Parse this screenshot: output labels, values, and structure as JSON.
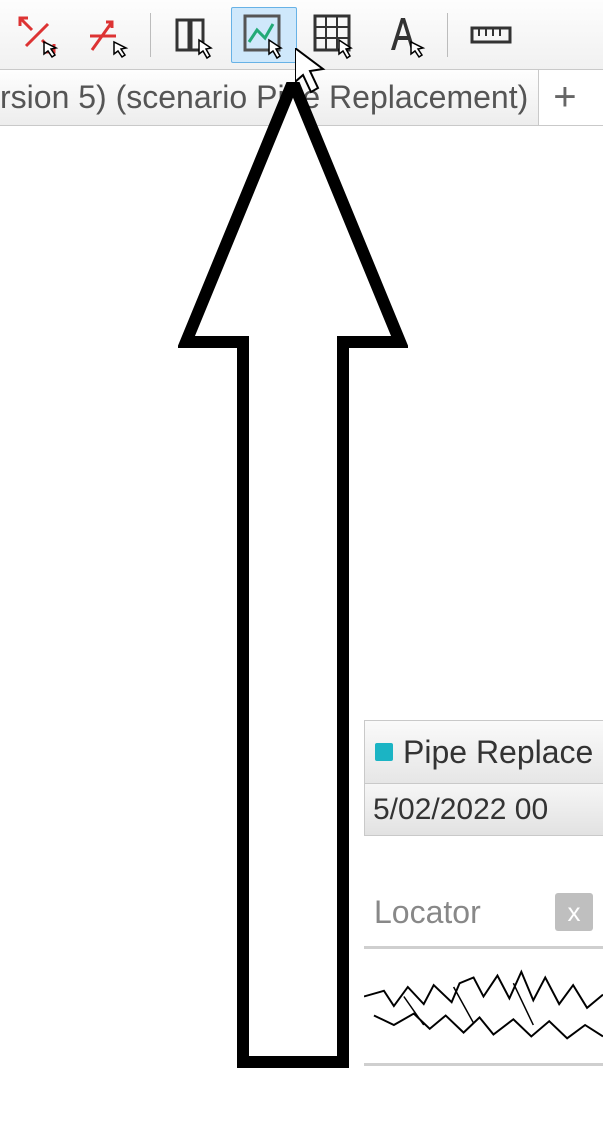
{
  "toolbar": {
    "items": [
      {
        "name": "collapse-arrow-tool",
        "separator_after": false
      },
      {
        "name": "arrow-tool",
        "separator_after": true
      },
      {
        "name": "select-table-tool",
        "separator_after": false
      },
      {
        "name": "chart-view-tool",
        "active": true,
        "separator_after": false
      },
      {
        "name": "grid-view-tool",
        "separator_after": false
      },
      {
        "name": "text-tool",
        "separator_after": true
      },
      {
        "name": "ruler-tool",
        "separator_after": false
      }
    ]
  },
  "tab": {
    "label": "rsion 5) (scenario Pipe Replacement)",
    "plus_label": "+"
  },
  "panel": {
    "title": "Pipe Replace",
    "date": "5/02/2022 00"
  },
  "locator": {
    "label": "Locator",
    "close_label": "x"
  }
}
